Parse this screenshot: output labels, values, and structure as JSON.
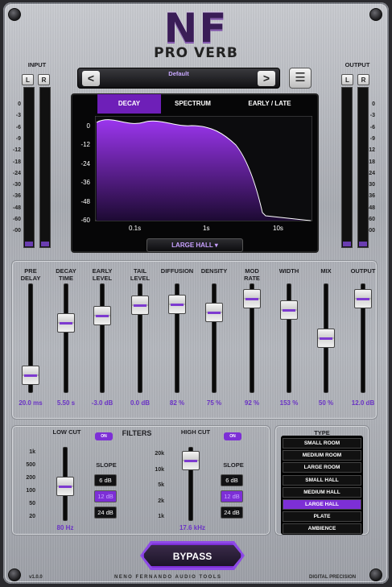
{
  "brand": {
    "logo": "NF",
    "product": "PRO VERB"
  },
  "input": {
    "label": "INPUT",
    "left": "L",
    "right": "R"
  },
  "output_meter": {
    "label": "OUTPUT",
    "left": "L",
    "right": "R"
  },
  "meter_scale": [
    "0",
    "-3",
    "-6",
    "-9",
    "-12",
    "-18",
    "-24",
    "-30",
    "-36",
    "-48",
    "-60",
    "-00"
  ],
  "preset": {
    "name": "Default",
    "prev": "<",
    "next": ">",
    "menu_icon": "hamburger-icon"
  },
  "display": {
    "tabs": [
      {
        "label": "DECAY",
        "active": true
      },
      {
        "label": "SPECTRUM",
        "active": false
      },
      {
        "label": "EARLY / LATE",
        "active": false
      }
    ],
    "y_ticks": [
      "0",
      "-12",
      "-24",
      "-36",
      "-48",
      "-60"
    ],
    "x_ticks": [
      "0.1s",
      "1s",
      "10s"
    ],
    "hall_select": "LARGE HALL ▾"
  },
  "faders": [
    {
      "label": "PRE\nDELAY",
      "value": "20.0 ms",
      "level": 0.1
    },
    {
      "label": "DECAY\nTIME",
      "value": "5.50 s",
      "level": 0.66
    },
    {
      "label": "EARLY\nLEVEL",
      "value": "-3.0 dB",
      "level": 0.74
    },
    {
      "label": "TAIL\nLEVEL",
      "value": "0.0 dB",
      "level": 0.85
    },
    {
      "label": "DIFFUSION",
      "value": "82 %",
      "level": 0.86
    },
    {
      "label": "DENSITY",
      "value": "75 %",
      "level": 0.78
    },
    {
      "label": "MOD\nRATE",
      "value": "92 %",
      "level": 0.92
    },
    {
      "label": "WIDTH",
      "value": "153 %",
      "level": 0.8
    },
    {
      "label": "MIX",
      "value": "50 %",
      "level": 0.5
    },
    {
      "label": "OUTPUT",
      "value": "12.0 dB",
      "level": 0.92
    }
  ],
  "filters": {
    "title": "FILTERS",
    "on": "ON",
    "low_cut": {
      "label": "LOW CUT",
      "value": "80 Hz",
      "level": 0.45,
      "scale": [
        "1k",
        "500",
        "200",
        "100",
        "50",
        "20"
      ]
    },
    "high_cut": {
      "label": "HIGH CUT",
      "value": "17.6 kHz",
      "level": 0.93,
      "scale": [
        "20k",
        "10k",
        "5k",
        "2k",
        "1k"
      ]
    },
    "slope_label": "SLOPE",
    "slopes": [
      "6 dB",
      "12 dB",
      "24 dB"
    ],
    "low_slope_active": 1,
    "high_slope_active": 1
  },
  "type": {
    "label": "TYPE",
    "items": [
      "SMALL ROOM",
      "MEDIUM ROOM",
      "LARGE ROOM",
      "SMALL HALL",
      "MEDIUM HALL",
      "LARGE HALL",
      "PLATE",
      "AMBIENCE"
    ],
    "active": 5
  },
  "bypass": "BYPASS",
  "footer": {
    "version": "v1.0.0",
    "company": "NENO FERNANDO AUDIO TOOLS",
    "tagline": "DIGITAL PRECISION"
  },
  "colors": {
    "accent": "#7d2fd6",
    "value_text": "#6a33c4"
  }
}
